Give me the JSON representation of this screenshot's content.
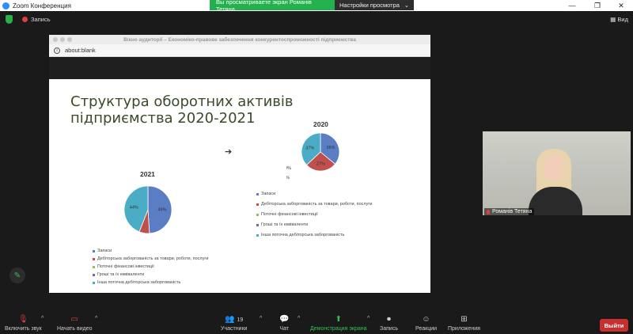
{
  "app": {
    "title": "Zoom Конференция"
  },
  "share_banner": {
    "message": "Вы просматриваете экран Романів Тетяна",
    "options_label": "Настройки просмотра"
  },
  "top": {
    "recording_label": "Запись",
    "view_label": "Вид"
  },
  "browser": {
    "window_title": "Вікно аудиторії – Економіко-правове забезпечення конкурентоспроможності підприємства",
    "url": "about:blank"
  },
  "slide": {
    "heading_line1": "Структура оборотних активів",
    "heading_line2": "підприємства 2020-2021",
    "arrow": "➔"
  },
  "chart_data": [
    {
      "type": "pie",
      "title": "2021",
      "labels": [
        "Запаси",
        "Дебіторська заборгованість за товари, роботи, послуги",
        "Поточні фінансові інвестиції",
        "Гроші та їх еквіваленти",
        "Інша поточна дебіторська заборгованість"
      ],
      "values": [
        49,
        7,
        0,
        0,
        44
      ],
      "data_labels": [
        "49%",
        "",
        "0%",
        "0%",
        "44%"
      ],
      "colors": [
        "#5b7dc3",
        "#c0504d",
        "#9bbb59",
        "#8064a2",
        "#4bacc6"
      ]
    },
    {
      "type": "pie",
      "title": "2020",
      "labels": [
        "Запаси",
        "Дебіторська заборгованість за товари, роботи, послуги",
        "Поточні фінансові інвестиції",
        "Гроші та їх еквіваленти",
        "Інша поточна дебіторська заборгованість"
      ],
      "values": [
        36,
        27,
        0,
        0,
        37
      ],
      "data_labels": [
        "36%",
        "27%",
        "0%",
        "0%",
        "37%"
      ],
      "colors": [
        "#5b7dc3",
        "#c0504d",
        "#9bbb59",
        "#8064a2",
        "#4bacc6"
      ]
    }
  ],
  "video": {
    "participant_name": "Романів Тетяна"
  },
  "toolbar": {
    "unmute_label": "Включить звук",
    "start_video_label": "Начать видео",
    "participants_label": "Участники",
    "participants_count": "19",
    "chat_label": "Чат",
    "share_label": "Демонстрация экрана",
    "record_label": "Запись",
    "reactions_label": "Реакции",
    "apps_label": "Приложения",
    "leave_label": "Выйти"
  }
}
